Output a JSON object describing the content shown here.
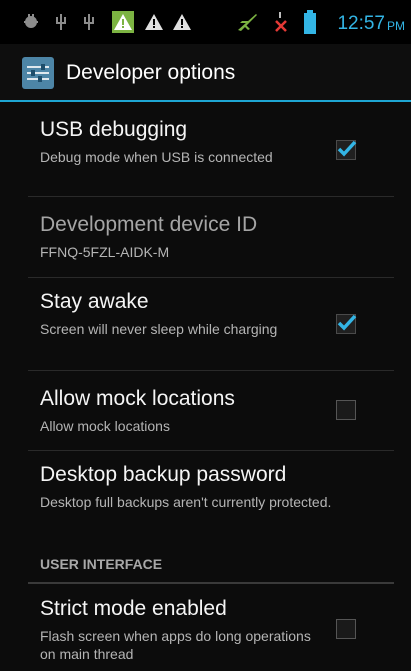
{
  "status_bar": {
    "time": "12:57",
    "ampm": "PM",
    "icons": [
      "usb-debug-icon",
      "usb-icon",
      "usb-icon",
      "warning-icon",
      "warning-icon",
      "warning-icon",
      "airplane-icon",
      "no-signal-icon",
      "battery-icon"
    ],
    "accent": "#33b5e5",
    "warning_color": "#7cb342"
  },
  "action_bar": {
    "title": "Developer options",
    "accent": "#1ea6d3"
  },
  "preferences": [
    {
      "title": "USB debugging",
      "summary": "Debug mode when USB is connected",
      "checked": true,
      "has_checkbox": true
    },
    {
      "title": "Development device ID",
      "summary": "FFNQ-5FZL-AIDK-M",
      "has_checkbox": false,
      "dim": true
    },
    {
      "title": "Stay awake",
      "summary": "Screen will never sleep while charging",
      "checked": true,
      "has_checkbox": true
    },
    {
      "title": "Allow mock locations",
      "summary": "Allow mock locations",
      "checked": false,
      "has_checkbox": true
    },
    {
      "title": "Desktop backup password",
      "summary": "Desktop full backups aren't currently protected.",
      "has_checkbox": false
    },
    {
      "title": "Strict mode enabled",
      "summary": "Flash screen when apps do long operations on main thread",
      "checked": false,
      "has_checkbox": true
    }
  ],
  "section": {
    "header": "USER INTERFACE"
  },
  "colors": {
    "check_blue": "#33b5e5"
  }
}
